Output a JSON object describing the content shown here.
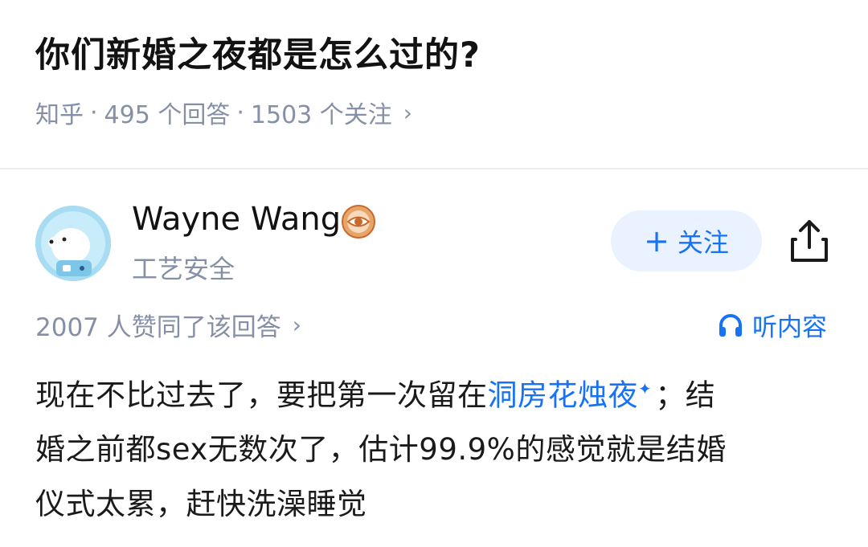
{
  "question": {
    "title": "你们新婚之夜都是怎么过的?",
    "source": "知乎",
    "answers": "495 个回答",
    "followers": "1503 个关注",
    "sep": "·",
    "chevron": "›"
  },
  "author": {
    "name": "Wayne Wang",
    "description": "工艺安全",
    "badge_icon": "eye-badge-icon",
    "avatar_icon": "polar-bear-astronaut-avatar"
  },
  "actions": {
    "follow_plus": "+",
    "follow_label": "关注",
    "share_icon": "share-icon"
  },
  "answer": {
    "votes": "2007 人赞同了该回答",
    "votes_chevron": "›",
    "listen_label": "听内容",
    "listen_icon": "headphones-icon",
    "line1_a": "现在不比过去了，要把第一次留在",
    "line1_link": "洞房花烛夜",
    "line1_spark": "✦",
    "line1_b": "；结",
    "line2": "婚之前都sex无数次了，估计99.9%的感觉就是结婚",
    "line3": "仪式太累，赶快洗澡睡觉"
  },
  "colors": {
    "accent": "#1772f6",
    "muted": "#8590a6",
    "follow_bg": "#e9f2fe",
    "badge": "#e07a2f"
  }
}
